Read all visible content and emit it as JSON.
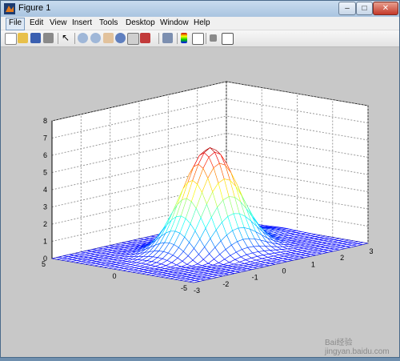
{
  "window": {
    "title": "Figure 1"
  },
  "menu": [
    "File",
    "Edit",
    "View",
    "Insert",
    "Tools",
    "Desktop",
    "Window",
    "Help"
  ],
  "toolbar_icons": [
    "new-figure-icon",
    "open-file-icon",
    "save-icon",
    "print-icon",
    "edit-plot-arrow-icon",
    "zoom-in-icon",
    "zoom-out-icon",
    "pan-hand-icon",
    "rotate-3d-icon",
    "data-cursor-icon",
    "brush-icon",
    "link-plot-icon",
    "colorbar-icon",
    "legend-icon",
    "hide-plot-tools-icon",
    "show-plot-tools-icon"
  ],
  "chart_data": {
    "type": "surface-mesh",
    "function": "peaks-like (single dominant peak)",
    "x": {
      "range": [
        -3,
        3
      ],
      "ticks": [
        -3,
        -2,
        -1,
        0,
        1,
        2,
        3
      ]
    },
    "y": {
      "range": [
        -5,
        5
      ],
      "ticks": [
        -5,
        0,
        5
      ]
    },
    "z": {
      "range": [
        0,
        8
      ],
      "ticks": [
        0,
        1,
        2,
        3,
        4,
        5,
        6,
        7,
        8
      ]
    },
    "peak": {
      "x": 0,
      "y": 0,
      "z": 6
    },
    "grid": true,
    "colormap": "jet"
  },
  "watermark": "Bai经验 jingyan.baidu.com"
}
